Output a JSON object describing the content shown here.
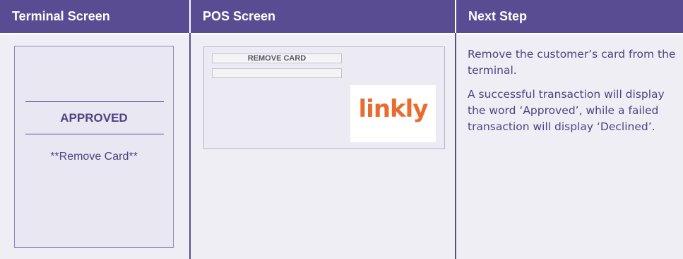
{
  "headers": {
    "terminal": "Terminal Screen",
    "pos": "POS Screen",
    "next_step": "Next Step"
  },
  "terminal": {
    "status": "APPROVED",
    "message": "**Remove Card**"
  },
  "pos": {
    "field1": "REMOVE CARD",
    "field2": "",
    "logo_text": "linkly"
  },
  "next_step": {
    "paragraph1": "Remove the customer’s card from the terminal.",
    "paragraph2": "A successful transaction will display the word ‘Approved’, while a failed transaction will display ‘Declined’."
  },
  "colors": {
    "header_bg": "#5a4c92",
    "cell_bg": "#efeef5",
    "text": "#4f427f",
    "logo": "#ea6b2e"
  }
}
